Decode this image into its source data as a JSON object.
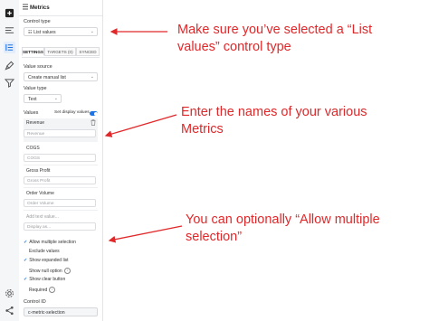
{
  "panel": {
    "title": "Metrics",
    "control_type_label": "Control type",
    "control_type_value": "List values",
    "tabs": [
      "SETTINGS",
      "TARGETS (0)",
      "SYNCED"
    ],
    "value_source_label": "Value source",
    "value_source_value": "Create manual list",
    "value_type_label": "Value type",
    "value_type_value": "Text",
    "values_label": "Values",
    "set_display_values_label": "Set display values",
    "values": [
      {
        "name": "Revenue",
        "display": "Revenue"
      },
      {
        "name": "COGS",
        "display": "COGS"
      },
      {
        "name": "Gross Profit",
        "display": "Gross Profit"
      },
      {
        "name": "Order Volume",
        "display": "Order Volume"
      }
    ],
    "add_text_placeholder": "Add text value...",
    "display_as_placeholder": "Display as...",
    "options": [
      {
        "label": "Allow multiple selection",
        "checked": true
      },
      {
        "label": "Exclude values",
        "checked": false
      },
      {
        "label": "Show expanded list",
        "checked": true
      },
      {
        "label": "Show null option",
        "checked": false
      },
      {
        "label": "Show clear button",
        "checked": true
      },
      {
        "label": "Required",
        "checked": false
      }
    ],
    "control_id_label": "Control ID",
    "control_id_value": "c-metric-selection"
  },
  "notes": {
    "note1_line1": "Make sure you’ve selected a “List",
    "note1_line2": "values” control type",
    "note2_line1": "Enter the names of your various",
    "note2_line2": "Metrics",
    "note3_line1": "You can optionally “Allow multiple",
    "note3_line2": "selection”"
  },
  "colors": {
    "annotation": "#e0282a",
    "accent": "#1a73e8"
  }
}
